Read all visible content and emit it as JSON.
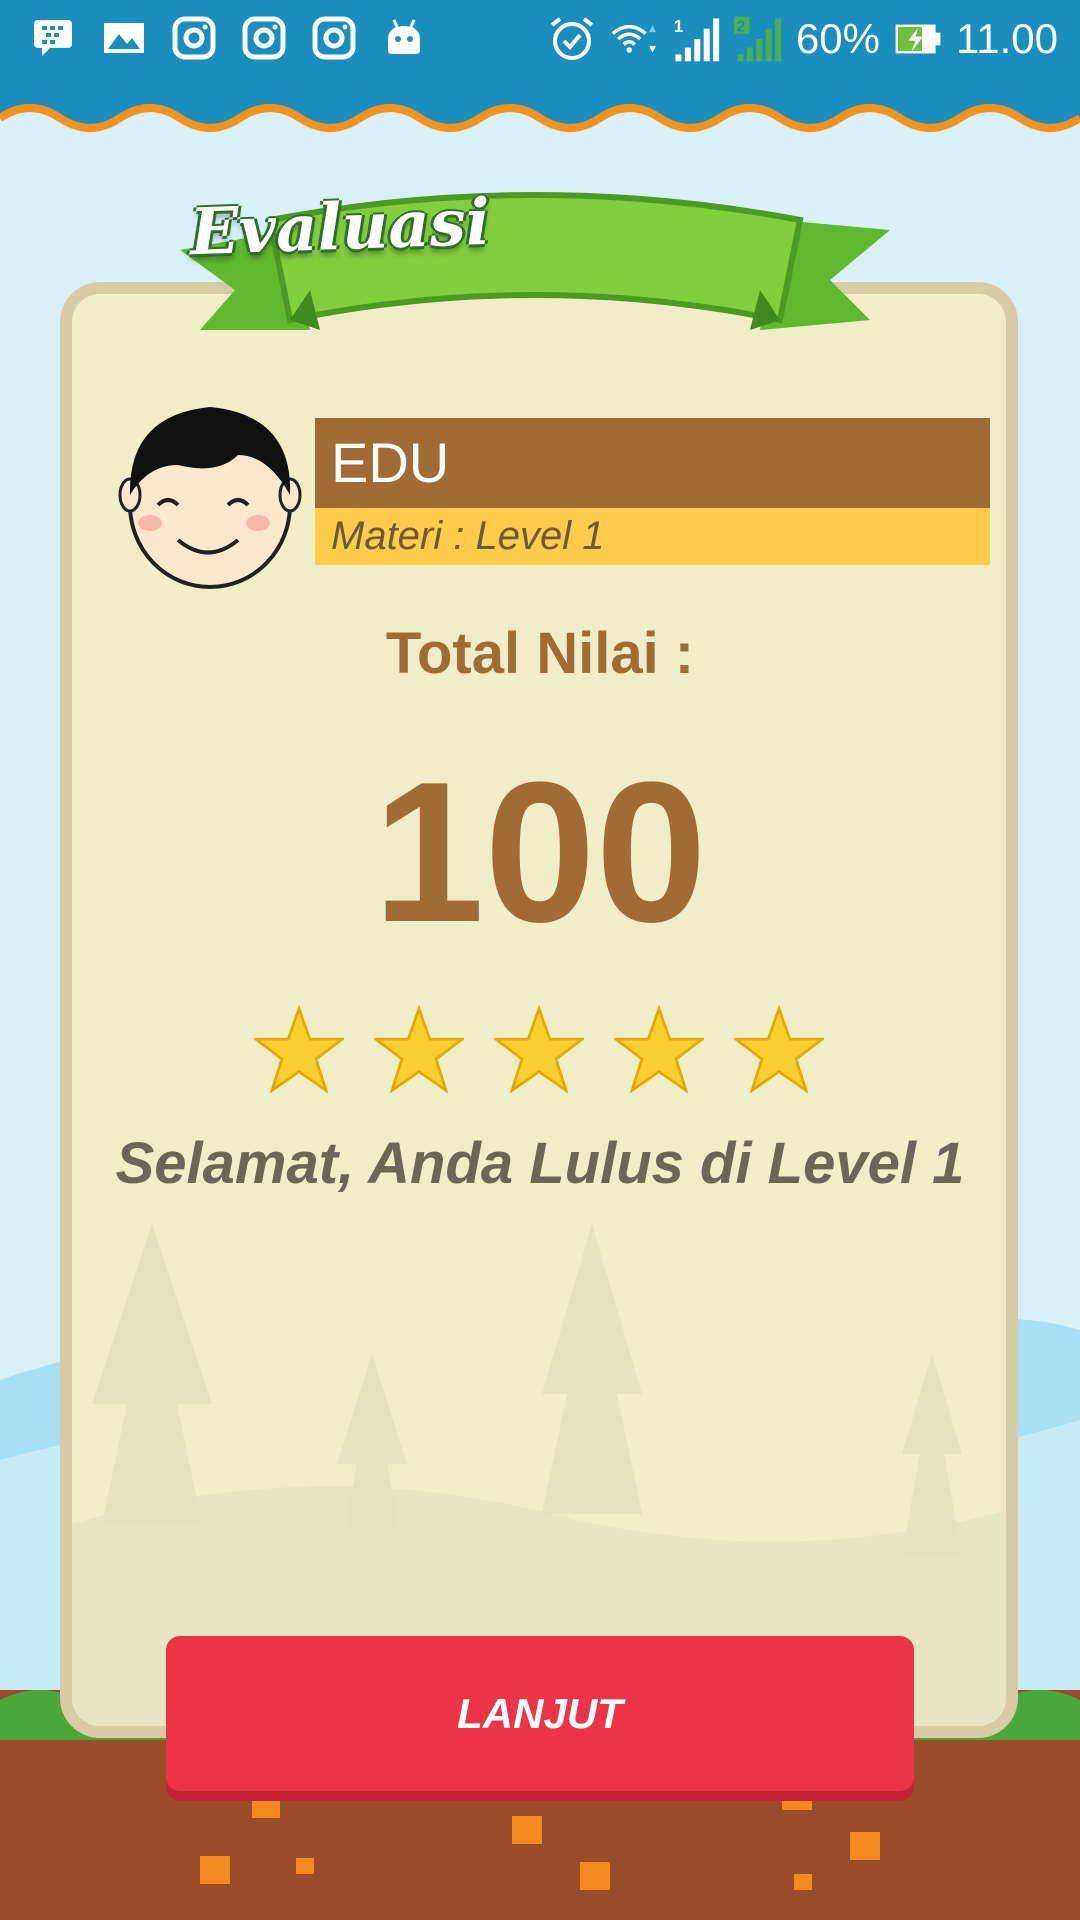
{
  "status_bar": {
    "battery": "60%",
    "time": "11.00",
    "icons": [
      "bbm-icon",
      "gallery-icon",
      "instagram-icon",
      "instagram-icon",
      "instagram-icon",
      "android-icon",
      "alarm-icon",
      "wifi-icon",
      "signal-sim1-icon",
      "signal-sim2-icon",
      "battery-charging-icon"
    ]
  },
  "header": {
    "title": "Evaluasi"
  },
  "profile": {
    "name": "EDU",
    "materi": "Materi : Level 1"
  },
  "result": {
    "total_label": "Total Nilai :",
    "score": "100",
    "stars_filled": 5,
    "stars_total": 5,
    "message": "Selamat, Anda Lulus di Level 1"
  },
  "actions": {
    "next_label": "LANJUT"
  },
  "colors": {
    "status_bar": "#1a8fbd",
    "brown": "#a06b35",
    "yellow": "#fccc4a",
    "button": "#ec3449",
    "ribbon_green": "#7cc93a"
  }
}
